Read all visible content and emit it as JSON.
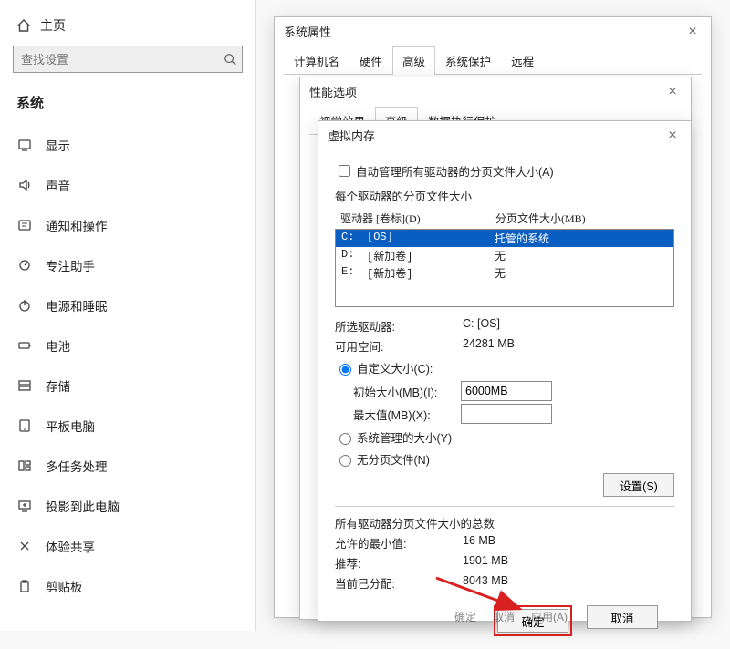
{
  "settings": {
    "home": "主页",
    "search_placeholder": "查找设置",
    "section": "系统",
    "items": [
      {
        "label": "显示",
        "icon": "display"
      },
      {
        "label": "声音",
        "icon": "sound"
      },
      {
        "label": "通知和操作",
        "icon": "notification"
      },
      {
        "label": "专注助手",
        "icon": "focus"
      },
      {
        "label": "电源和睡眠",
        "icon": "power"
      },
      {
        "label": "电池",
        "icon": "battery"
      },
      {
        "label": "存储",
        "icon": "storage"
      },
      {
        "label": "平板电脑",
        "icon": "tablet"
      },
      {
        "label": "多任务处理",
        "icon": "multitask"
      },
      {
        "label": "投影到此电脑",
        "icon": "project"
      },
      {
        "label": "体验共享",
        "icon": "share"
      },
      {
        "label": "剪贴板",
        "icon": "clipboard"
      }
    ]
  },
  "sysprop": {
    "title": "系统属性",
    "tabs": [
      "计算机名",
      "硬件",
      "高级",
      "系统保护",
      "远程"
    ],
    "active_tab": "高级"
  },
  "perf": {
    "title": "性能选项",
    "tabs": [
      "视觉效果",
      "高级",
      "数据执行保护"
    ],
    "active_tab": "高级"
  },
  "vmem": {
    "title": "虚拟内存",
    "auto_manage_label": "自动管理所有驱动器的分页文件大小(A)",
    "auto_manage_checked": false,
    "each_drive_label": "每个驱动器的分页文件大小",
    "col_drive": "驱动器 [卷标](D)",
    "col_size": "分页文件大小(MB)",
    "drives": [
      {
        "drv": "C:",
        "label": "[OS]",
        "size": "托管的系统",
        "selected": true
      },
      {
        "drv": "D:",
        "label": "[新加卷]",
        "size": "无",
        "selected": false
      },
      {
        "drv": "E:",
        "label": "[新加卷]",
        "size": "无",
        "selected": false
      }
    ],
    "selected_drive_label": "所选驱动器:",
    "selected_drive_value": "C: [OS]",
    "free_space_label": "可用空间:",
    "free_space_value": "24281 MB",
    "custom_size_label": "自定义大小(C):",
    "custom_checked": true,
    "initial_label": "初始大小(MB)(I):",
    "initial_value": "6000MB",
    "max_label": "最大值(MB)(X):",
    "max_value": "",
    "system_managed_label": "系统管理的大小(Y)",
    "no_paging_label": "无分页文件(N)",
    "set_button": "设置(S)",
    "totals_title": "所有驱动器分页文件大小的总数",
    "min_label": "允许的最小值:",
    "min_value": "16 MB",
    "rec_label": "推荐:",
    "rec_value": "1901 MB",
    "cur_label": "当前已分配:",
    "cur_value": "8043 MB",
    "ok": "确定",
    "cancel": "取消"
  },
  "bottom": {
    "ok": "确定",
    "cancel": "取消",
    "apply": "应用(A)"
  }
}
